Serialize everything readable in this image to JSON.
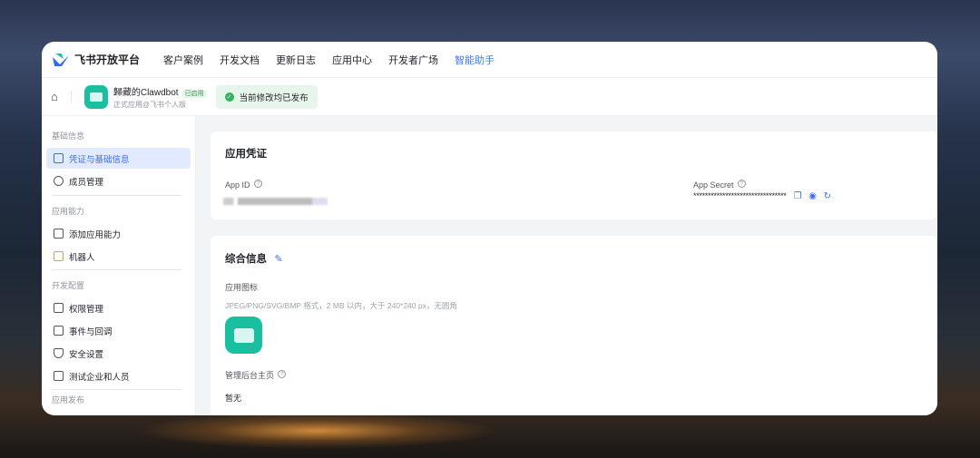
{
  "header": {
    "brand": "飞书开放平台",
    "nav": [
      "客户案例",
      "开发文档",
      "更新日志",
      "应用中心",
      "开发者广场",
      "智能助手"
    ]
  },
  "app": {
    "name": "歸藏的Clawdbot",
    "badge": "已启用",
    "subtitle": "正式应用@飞书个人版",
    "status": "当前修改均已发布"
  },
  "sidebar": {
    "groups": [
      {
        "title": "基础信息",
        "items": [
          "凭证与基础信息",
          "成员管理"
        ]
      },
      {
        "title": "应用能力",
        "items": [
          "添加应用能力",
          "机器人"
        ]
      },
      {
        "title": "开发配置",
        "items": [
          "权限管理",
          "事件与回调",
          "安全设置",
          "测试企业和人员"
        ]
      },
      {
        "title": "应用发布",
        "items": []
      }
    ]
  },
  "credentials": {
    "title": "应用凭证",
    "app_id_label": "App ID",
    "app_secret_label": "App Secret",
    "app_secret_value": "********************************"
  },
  "info": {
    "title": "综合信息",
    "icon_label": "应用图标",
    "icon_hint": "JPEG/PNG/SVG/BMP 格式，2 MB 以内，大于 240*240 px，无圆角",
    "homepage_label": "管理后台主页",
    "homepage_value": "暂无"
  },
  "colors": {
    "accent": "#3b6cf6",
    "app_icon": "#18c0a0"
  }
}
